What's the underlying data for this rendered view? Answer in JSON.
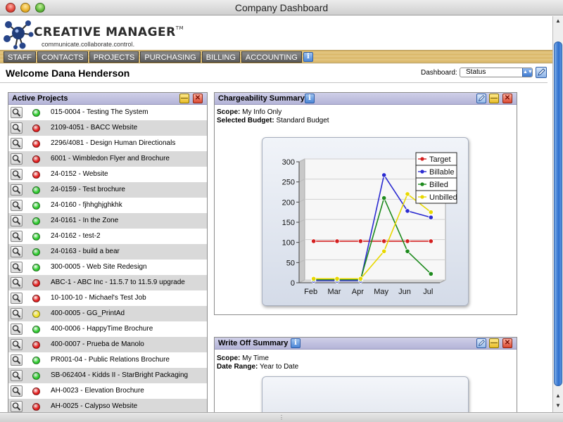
{
  "window": {
    "title": "Company Dashboard"
  },
  "logo": {
    "name": "CREATIVE MANAGER",
    "tm": "TM",
    "tagline": "communicate.collaborate.control."
  },
  "nav": {
    "tabs": [
      "STAFF",
      "CONTACTS",
      "PROJECTS",
      "PURCHASING",
      "BILLING",
      "ACCOUNTING"
    ],
    "info": "i"
  },
  "header": {
    "welcome": "Welcome Dana Henderson",
    "dashboard_label": "Dashboard:",
    "dashboard_value": "Status"
  },
  "colors": {
    "accent": "#b4b4d8",
    "nav": "#d3aa52",
    "green": "#2ecc2e",
    "red": "#e41f1f",
    "yellow": "#f2e428"
  },
  "active_projects": {
    "title": "Active Projects",
    "rows": [
      {
        "name": "015-0004 - Testing The System",
        "status": "green"
      },
      {
        "name": "2109-4051 - BACC Website",
        "status": "red"
      },
      {
        "name": "2296/4081 - Design Human Directionals",
        "status": "red"
      },
      {
        "name": "6001 - Wimbledon Flyer and Brochure",
        "status": "red"
      },
      {
        "name": "24-0152 - Website",
        "status": "red"
      },
      {
        "name": "24-0159 - Test brochure",
        "status": "green"
      },
      {
        "name": "24-0160 - fjhhghjghkhk",
        "status": "green"
      },
      {
        "name": "24-0161 - In the Zone",
        "status": "green"
      },
      {
        "name": "24-0162 - test-2",
        "status": "green"
      },
      {
        "name": "24-0163 - build a bear",
        "status": "green"
      },
      {
        "name": "300-0005 - Web Site Redesign",
        "status": "green"
      },
      {
        "name": "ABC-1 - ABC Inc - 11.5.7 to 11.5.9 upgrade",
        "status": "red"
      },
      {
        "name": "10-100-10 - Michael's Test Job",
        "status": "red"
      },
      {
        "name": "400-0005 - GG_PrintAd",
        "status": "yellow"
      },
      {
        "name": "400-0006 - HappyTime Brochure",
        "status": "green"
      },
      {
        "name": "400-0007 - Prueba de Manolo",
        "status": "red"
      },
      {
        "name": "PR001-04 - Public Relations Brochure",
        "status": "green"
      },
      {
        "name": "SB-062404 - Kidds II - StarBright Packaging",
        "status": "green"
      },
      {
        "name": "AH-0023 - Elevation Brochure",
        "status": "red"
      },
      {
        "name": "AH-0025 - Calypso Website",
        "status": "red"
      }
    ]
  },
  "chargeability": {
    "title": "Chargeability Summary",
    "scope_label": "Scope:",
    "scope_value": "My Info Only",
    "budget_label": "Selected Budget:",
    "budget_value": "Standard Budget"
  },
  "writeoff": {
    "title": "Write Off Summary",
    "scope_label": "Scope:",
    "scope_value": "My Time",
    "range_label": "Date Range:",
    "range_value": "Year to Date"
  },
  "chart_data": {
    "type": "line",
    "title": "",
    "xlabel": "",
    "ylabel": "",
    "categories": [
      "Feb",
      "Mar",
      "Apr",
      "May",
      "Jun",
      "Jul"
    ],
    "ylim": [
      0,
      300
    ],
    "yticks": [
      0,
      50,
      100,
      150,
      200,
      250,
      300
    ],
    "grid": true,
    "legend": "top-right",
    "series": [
      {
        "name": "Target",
        "color": "#d42020",
        "values": [
          103,
          103,
          103,
          103,
          103,
          103
        ]
      },
      {
        "name": "Billable",
        "color": "#2b2bd0",
        "values": [
          5,
          5,
          5,
          267,
          178,
          162
        ]
      },
      {
        "name": "Billed",
        "color": "#1d8a1d",
        "values": [
          8,
          8,
          8,
          210,
          78,
          22
        ]
      },
      {
        "name": "Unbilled",
        "color": "#e8d800",
        "values": [
          10,
          10,
          10,
          78,
          220,
          175
        ]
      }
    ]
  }
}
